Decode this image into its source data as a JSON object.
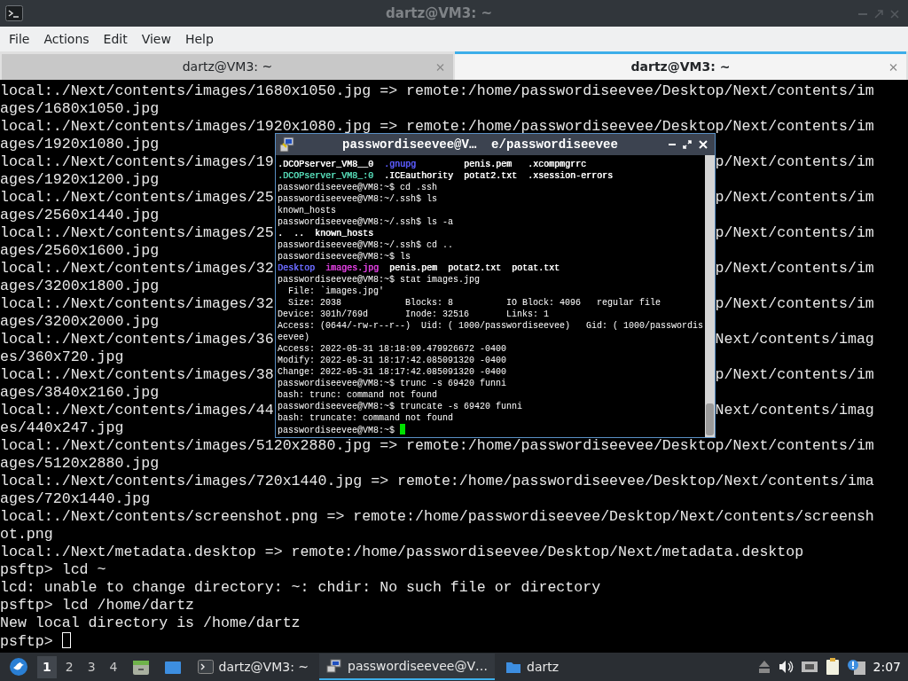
{
  "window": {
    "title": "dartz@VM3: ~",
    "active": false
  },
  "menu": [
    "File",
    "Actions",
    "Edit",
    "View",
    "Help"
  ],
  "tabs": [
    {
      "label": "dartz@VM3: ~",
      "selected": false
    },
    {
      "label": "dartz@VM3: ~",
      "selected": true
    }
  ],
  "terminal": {
    "lines": [
      {
        "text": "local:./Next/contents/images/1680x1050.jpg => remote:/home/passwordiseevee/Desktop/Next/contents/im"
      },
      {
        "text": "ages/1680x1050.jpg"
      },
      {
        "text": "local:./Next/contents/images/1920x1080.jpg => remote:/home/passwordiseevee/Desktop/Next/contents/im"
      },
      {
        "text": "ages/1920x1080.jpg"
      },
      {
        "left": "local:./Next/contents/images/19",
        "right": "p/Next/contents/im"
      },
      {
        "text": "ages/1920x1200.jpg"
      },
      {
        "left": "local:./Next/contents/images/25",
        "right": "p/Next/contents/im"
      },
      {
        "text": "ages/2560x1440.jpg"
      },
      {
        "left": "local:./Next/contents/images/25",
        "right": "p/Next/contents/im"
      },
      {
        "text": "ages/2560x1600.jpg"
      },
      {
        "left": "local:./Next/contents/images/32",
        "right": "p/Next/contents/im"
      },
      {
        "text": "ages/3200x1800.jpg"
      },
      {
        "left": "local:./Next/contents/images/32",
        "right": "p/Next/contents/im"
      },
      {
        "text": "ages/3200x2000.jpg"
      },
      {
        "left": "local:./Next/contents/images/36",
        "right": "Next/contents/imag"
      },
      {
        "text": "es/360x720.jpg"
      },
      {
        "left": "local:./Next/contents/images/38",
        "right": "p/Next/contents/im"
      },
      {
        "text": "ages/3840x2160.jpg"
      },
      {
        "left": "local:./Next/contents/images/44",
        "right": "Next/contents/imag"
      },
      {
        "text": "es/440x247.jpg"
      },
      {
        "text": "local:./Next/contents/images/5120x2880.jpg => remote:/home/passwordiseevee/Desktop/Next/contents/im"
      },
      {
        "text": "ages/5120x2880.jpg"
      },
      {
        "text": "local:./Next/contents/images/720x1440.jpg => remote:/home/passwordiseevee/Desktop/Next/contents/ima"
      },
      {
        "text": "ages/720x1440.jpg"
      },
      {
        "text": "local:./Next/contents/screenshot.png => remote:/home/passwordiseevee/Desktop/Next/contents/screensh"
      },
      {
        "text": "ot.png"
      },
      {
        "text": "local:./Next/metadata.desktop => remote:/home/passwordiseevee/Desktop/Next/metadata.desktop"
      },
      {
        "text": "psftp> lcd ~"
      },
      {
        "text": "lcd: unable to change directory: ~: chdir: No such file or directory"
      },
      {
        "text": "psftp> lcd /home/dartz"
      },
      {
        "text": "New local directory is /home/dartz"
      },
      {
        "text": "psftp> "
      }
    ]
  },
  "inner_window": {
    "title": "passwordiseevee@V…  e/passwordiseevee",
    "active": true,
    "lines": [
      {
        "kind": "ls",
        "rows": [
          [
            {
              "text": ".DCOPserver_VM8__0",
              "color": "#ffffff"
            },
            {
              "text": ".gnupg",
              "color": "#5c5cff"
            },
            {
              "text": "penis.pem",
              "color": "#ffffff"
            },
            {
              "text": ".xcompmgrrc",
              "color": "#ffffff"
            }
          ],
          [
            {
              "text": ".DCOPserver_VM8_:0",
              "color": "#55d7b4"
            },
            {
              "text": ".ICEauthority",
              "color": "#ffffff"
            },
            {
              "text": "potat2.txt",
              "color": "#ffffff"
            },
            {
              "text": ".xsession-errors",
              "color": "#ffffff"
            }
          ]
        ]
      },
      {
        "kind": "text",
        "text": "passwordiseevee@VM8:~$ cd .ssh"
      },
      {
        "kind": "text",
        "text": "passwordiseevee@VM8:~/.ssh$ ls"
      },
      {
        "kind": "text",
        "text": "known_hosts"
      },
      {
        "kind": "text",
        "text": "passwordiseevee@VM8:~/.ssh$ ls -a"
      },
      {
        "kind": "ls",
        "rows": [
          [
            {
              "text": "."
            },
            {
              "text": ".."
            },
            {
              "text": "known_hosts"
            }
          ]
        ]
      },
      {
        "kind": "text",
        "text": "passwordiseevee@VM8:~/.ssh$ cd .."
      },
      {
        "kind": "text",
        "text": "passwordiseevee@VM8:~$ ls"
      },
      {
        "kind": "ls",
        "rows": [
          [
            {
              "text": "Desktop",
              "color": "#6b6bff"
            },
            {
              "text": "images.jpg",
              "color": "#e040e0"
            },
            {
              "text": "penis.pem",
              "color": "#ffffff"
            },
            {
              "text": "potat2.txt",
              "color": "#ffffff"
            },
            {
              "text": "potat.txt",
              "color": "#ffffff"
            }
          ]
        ]
      },
      {
        "kind": "text",
        "text": "passwordiseevee@VM8:~$ stat images.jpg"
      },
      {
        "kind": "text",
        "text": "  File: `images.jpg'"
      },
      {
        "kind": "text",
        "text": "  Size: 2038            Blocks: 8          IO Block: 4096   regular file"
      },
      {
        "kind": "text",
        "text": "Device: 301h/769d       Inode: 32516       Links: 1"
      },
      {
        "kind": "text",
        "text": "Access: (0644/-rw-r--r--)  Uid: ( 1000/passwordiseevee)   Gid: ( 1000/passwordis"
      },
      {
        "kind": "text",
        "text": "eevee)"
      },
      {
        "kind": "text",
        "text": "Access: 2022-05-31 18:18:09.479926672 -0400"
      },
      {
        "kind": "text",
        "text": "Modify: 2022-05-31 18:17:42.085091320 -0400"
      },
      {
        "kind": "text",
        "text": "Change: 2022-05-31 18:17:42.085091320 -0400"
      },
      {
        "kind": "text",
        "text": "passwordiseevee@VM8:~$ trunc -s 69420 funni"
      },
      {
        "kind": "text",
        "text": "bash: trunc: command not found"
      },
      {
        "kind": "text",
        "text": "passwordiseevee@VM8:~$ truncate -s 69420 funni"
      },
      {
        "kind": "text",
        "text": "bash: truncate: command not found"
      },
      {
        "kind": "prompt",
        "text": "passwordiseevee@VM8:~$ "
      }
    ]
  },
  "taskbar": {
    "workspaces": [
      {
        "label": "1",
        "selected": true
      },
      {
        "label": "2",
        "selected": false
      },
      {
        "label": "3",
        "selected": false
      },
      {
        "label": "4",
        "selected": false
      }
    ],
    "tasks": [
      {
        "label": "dartz@VM3: ~",
        "kind": "terminal",
        "selected": false
      },
      {
        "label": "passwordiseevee@V…",
        "kind": "remote",
        "selected": true
      },
      {
        "label": "dartz",
        "kind": "folder",
        "selected": false
      }
    ],
    "clock": "2:07"
  }
}
